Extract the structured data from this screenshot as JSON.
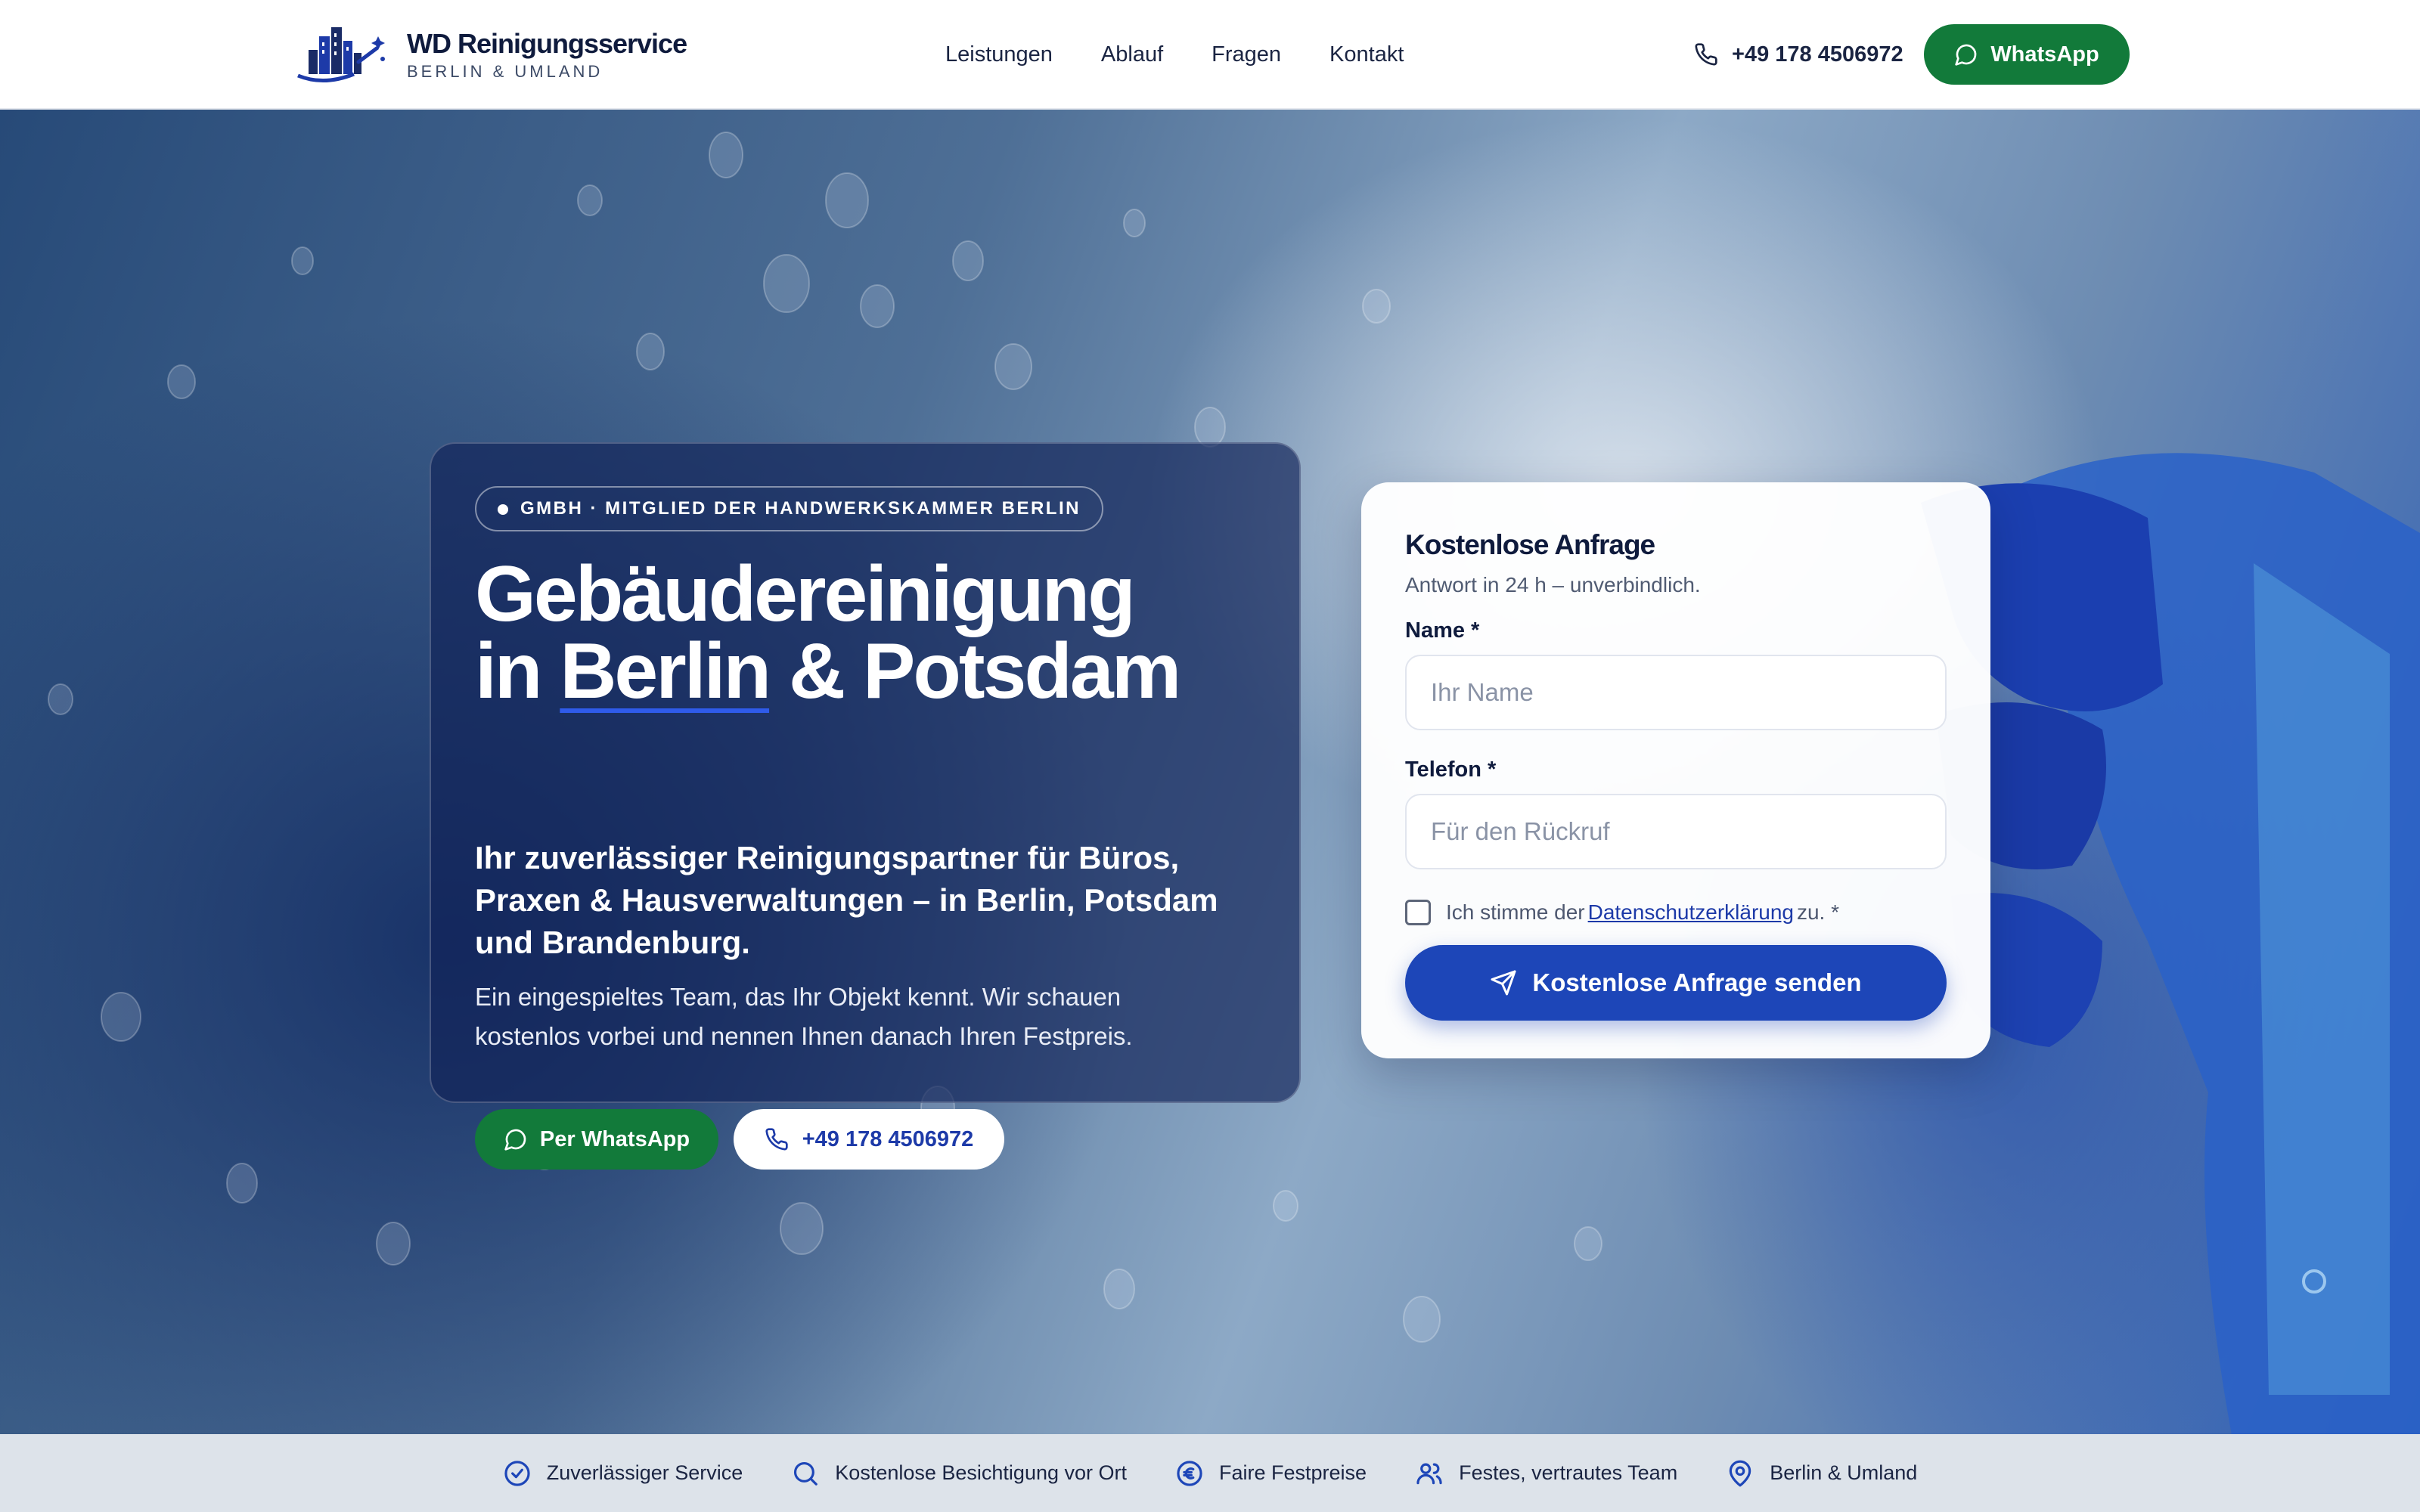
{
  "header": {
    "brand_name": "WD Reinigungsservice",
    "brand_sub": "BERLIN & UMLAND",
    "nav": [
      "Leistungen",
      "Ablauf",
      "Fragen",
      "Kontakt"
    ],
    "phone": "+49 178 4506972",
    "whatsapp_label": "WhatsApp"
  },
  "hero": {
    "badge": "GMBH · MITGLIED DER HANDWERKSKAMMER BERLIN",
    "title_line1": "Gebäudereinigung",
    "title_in": "in",
    "title_city": "Berlin",
    "title_rest": "& Potsdam",
    "lead": "Ihr zuverlässiger Reinigungspartner für Büros, Praxen & Hausverwaltungen – in Berlin, Potsdam und Brandenburg.",
    "body": "Ein eingespieltes Team, das Ihr Objekt kennt. Wir schauen kostenlos vorbei und nennen Ihnen danach Ihren Festpreis.",
    "btn_whatsapp": "Per WhatsApp",
    "btn_phone": "+49 178 4506972"
  },
  "form": {
    "title": "Kostenlose Anfrage",
    "subtitle": "Antwort in 24 h – unverbindlich.",
    "name_label": "Name *",
    "name_placeholder": "Ihr Name",
    "phone_label": "Telefon *",
    "phone_placeholder": "Für den Rückruf",
    "consent_before": "Ich stimme der",
    "consent_link": "Datenschutzerklärung",
    "consent_after": "zu. *",
    "consent_checked": false,
    "submit_label": "Kostenlose Anfrage senden"
  },
  "trust": [
    {
      "icon": "check-badge-icon",
      "label": "Zuverlässiger Service"
    },
    {
      "icon": "search-icon",
      "label": "Kostenlose Besichtigung vor Ort"
    },
    {
      "icon": "euro-icon",
      "label": "Faire Festpreise"
    },
    {
      "icon": "users-icon",
      "label": "Festes, vertrautes Team"
    },
    {
      "icon": "map-pin-icon",
      "label": "Berlin & Umland"
    }
  ],
  "colors": {
    "primary_blue": "#1d46b8",
    "whatsapp_green": "#127a3a",
    "text_dark": "#0f1b3d",
    "trust_bar": "#dde3ea"
  }
}
